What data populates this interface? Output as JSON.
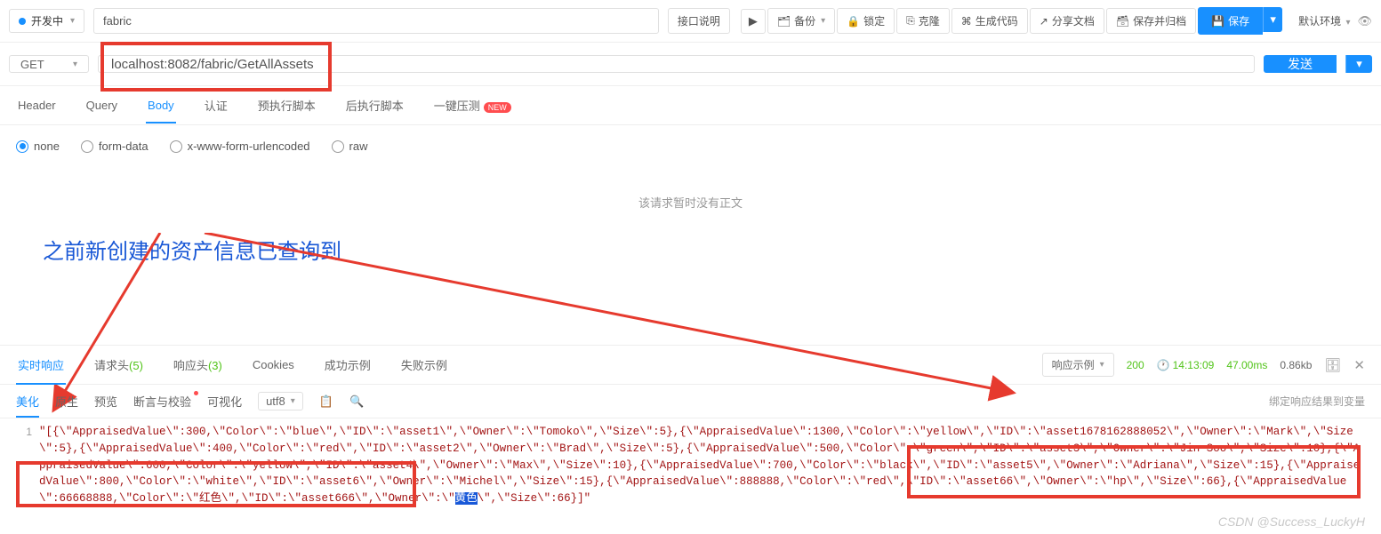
{
  "top": {
    "status_label": "开发中",
    "api_name": "fabric",
    "buttons": {
      "api_desc": "接口说明",
      "backup": "备份",
      "lock": "锁定",
      "clone": "克隆",
      "gen_code": "生成代码",
      "share_doc": "分享文档",
      "save_archive": "保存并归档",
      "save": "保存"
    },
    "env_label": "默认环境"
  },
  "request": {
    "method": "GET",
    "url": "localhost:8082/fabric/GetAllAssets",
    "send": "发送"
  },
  "tabs": {
    "header": "Header",
    "query": "Query",
    "body": "Body",
    "auth": "认证",
    "pre_script": "预执行脚本",
    "post_script": "后执行脚本",
    "compress": "一键压测"
  },
  "body_types": {
    "none": "none",
    "form_data": "form-data",
    "urlencoded": "x-www-form-urlencoded",
    "raw": "raw"
  },
  "empty_body_msg": "该请求暂时没有正文",
  "annotation_text": "之前新创建的资产信息已查询到",
  "resp_tabs": {
    "realtime": "实时响应",
    "req_headers": "请求头",
    "req_headers_count": "(5)",
    "resp_headers": "响应头",
    "resp_headers_count": "(3)",
    "cookies": "Cookies",
    "success": "成功示例",
    "fail": "失败示例"
  },
  "resp_meta": {
    "example_btn": "响应示例",
    "status": "200",
    "time": "14:13:09",
    "duration": "47.00ms",
    "size": "0.86kb"
  },
  "resp_tools": {
    "beautify": "美化",
    "raw": "原生",
    "preview": "预览",
    "assert": "断言与校验",
    "visualize": "可视化",
    "encoding": "utf8",
    "bind_var": "绑定响应结果到变量"
  },
  "resp_line_no": "1",
  "resp_json_text": "\"[{\\\"AppraisedValue\\\":300,\\\"Color\\\":\\\"blue\\\",\\\"ID\\\":\\\"asset1\\\",\\\"Owner\\\":\\\"Tomoko\\\",\\\"Size\\\":5},{\\\"AppraisedValue\\\":1300,\\\"Color\\\":\\\"yellow\\\",\\\"ID\\\":\\\"asset1678162888052\\\",\\\"Owner\\\":\\\"Mark\\\",\\\"Size\\\":5},{\\\"AppraisedValue\\\":400,\\\"Color\\\":\\\"red\\\",\\\"ID\\\":\\\"asset2\\\",\\\"Owner\\\":\\\"Brad\\\",\\\"Size\\\":5},{\\\"AppraisedValue\\\":500,\\\"Color\\\":\\\"green\\\",\\\"ID\\\":\\\"asset3\\\",\\\"Owner\\\":\\\"Jin Soo\\\",\\\"Size\\\":10},{\\\"AppraisedValue\\\":600,\\\"Color\\\":\\\"yellow\\\",\\\"ID\\\":\\\"asset4\\\",\\\"Owner\\\":\\\"Max\\\",\\\"Size\\\":10},{\\\"AppraisedValue\\\":700,\\\"Color\\\":\\\"black\\\",\\\"ID\\\":\\\"asset5\\\",\\\"Owner\\\":\\\"Adriana\\\",\\\"Size\\\":15},{\\\"AppraisedValue\\\":800,\\\"Color\\\":\\\"white\\\",\\\"ID\\\":\\\"asset6\\\",\\\"Owner\\\":\\\"Michel\\\",\\\"Size\\\":15},{\\\"AppraisedValue\\\":888888,\\\"Color\\\":\\\"red\\\",\\\"ID\\\":\\\"asset66\\\",\\\"Owner\\\":\\\"hp\\\",\\\"Size\\\":66},{\\\"AppraisedValue\\\":66668888,\\\"Color\\\":\\\"红色\\\",\\\"ID\\\":\\\"asset666\\\",\\\"Owner\\\":\\\"",
  "resp_json_hl": "黄色",
  "resp_json_tail": "\\\",\\\"Size\\\":66}]\"",
  "watermark": "CSDN @Success_LuckyH"
}
